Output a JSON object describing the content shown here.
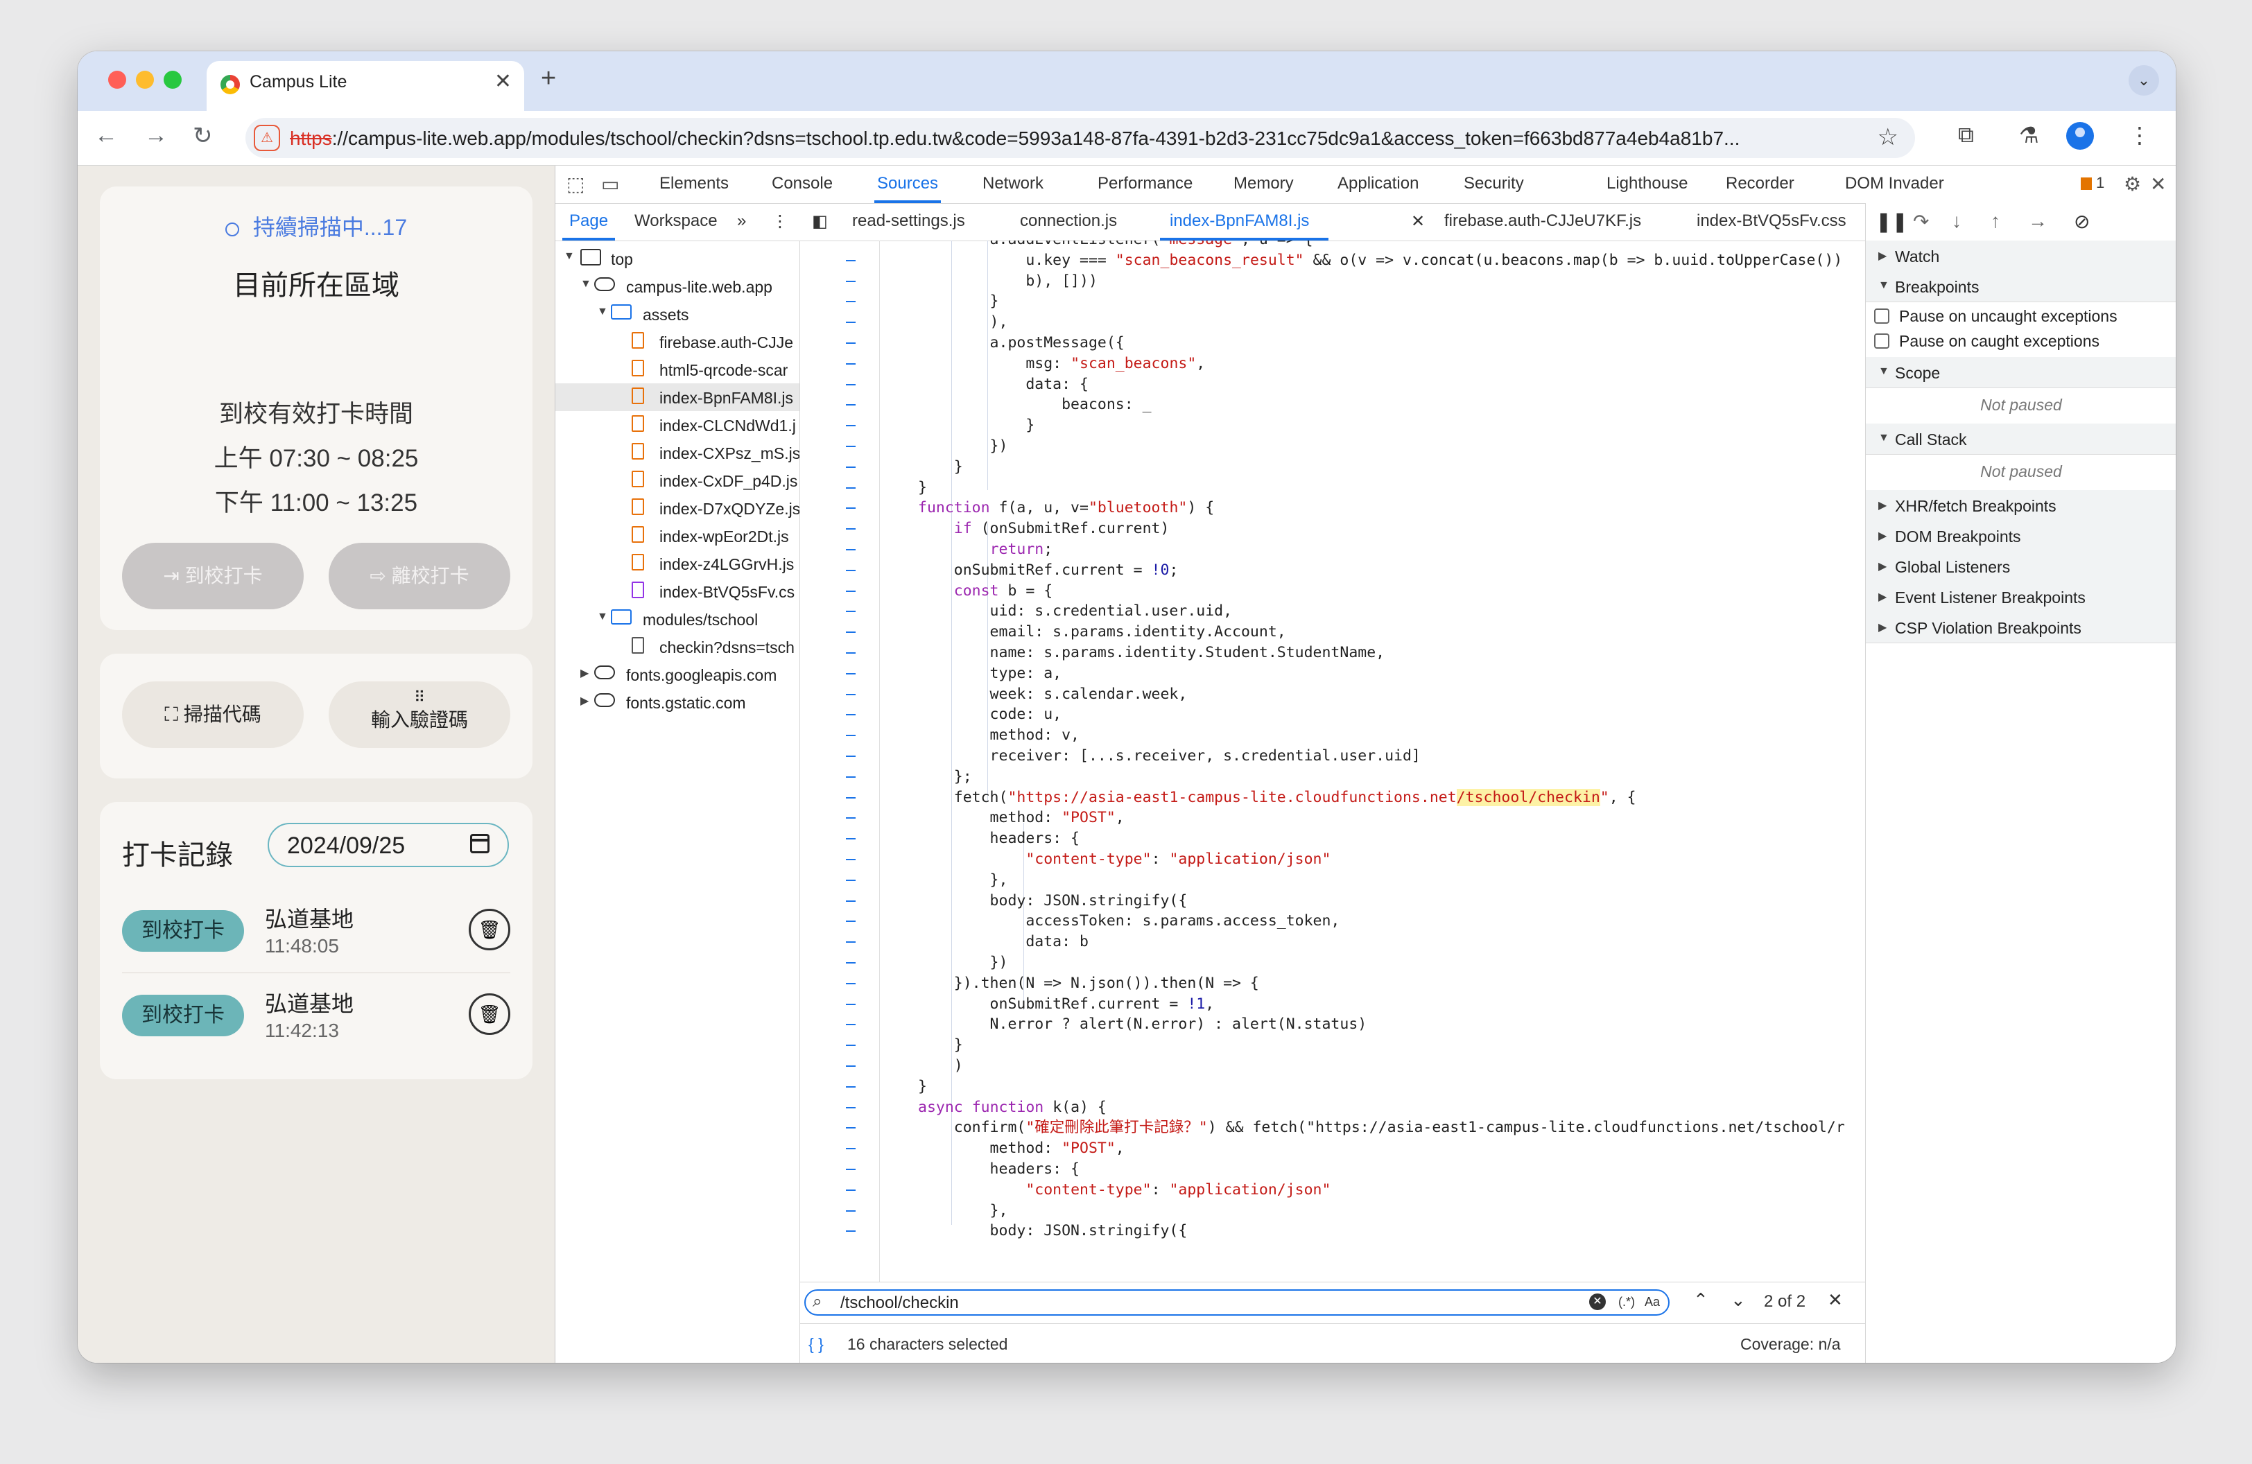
{
  "browser": {
    "tab_title": "Campus Lite",
    "tab_close": "✕",
    "new_tab": "+",
    "url_scheme": "https",
    "url_rest": "://campus-lite.web.app/modules/tschool/checkin?dsns=tschool.tp.edu.tw&code=5993a148-87fa-4391-b2d3-231cc75dc9a1&access_token=f663bd877a4eb4a81b7..."
  },
  "app": {
    "scan_status": "持續掃描中...17",
    "area_title": "目前所在區域",
    "time_title": "到校有效打卡時間",
    "time_morning": "上午 07:30 ~ 08:25",
    "time_noon": "下午 11:00 ~ 13:25",
    "arrive_button": "到校打卡",
    "leave_button": "離校打卡",
    "scan_code_button": "掃描代碼",
    "enter_code_button": "輸入驗證碼",
    "record_title": "打卡記錄",
    "record_date": "2024/09/25",
    "records": [
      {
        "type": "到校打卡",
        "location": "弘道基地",
        "time": "11:48:05"
      },
      {
        "type": "到校打卡",
        "location": "弘道基地",
        "time": "11:42:13"
      }
    ]
  },
  "devtools": {
    "tabs": [
      "Elements",
      "Console",
      "Sources",
      "Network",
      "Performance",
      "Memory",
      "Application",
      "Security",
      "Lighthouse",
      "Recorder",
      "DOM Invader"
    ],
    "active_tab": "Sources",
    "issues_count": "1",
    "nav_tabs": [
      "Page",
      "Workspace"
    ],
    "file_tabs": [
      "read-settings.js",
      "connection.js",
      "index-BpnFAM8I.js",
      "firebase.auth-CJJeU7KF.js",
      "index-BtVQ5sFv.css"
    ],
    "tree": {
      "top": "top",
      "domain": "campus-lite.web.app",
      "assets": "assets",
      "files": [
        "firebase.auth-CJJe",
        "html5-qrcode-scar",
        "index-BpnFAM8I.js",
        "index-CLCNdWd1.j",
        "index-CXPsz_mS.js",
        "index-CxDF_p4D.js",
        "index-D7xQDYZe.js",
        "index-wpEor2Dt.js",
        "index-z4LGGrvH.js",
        "index-BtVQ5sFv.cs"
      ],
      "modules": "modules/tschool",
      "checkin": "checkin?dsns=tsch",
      "fonts1": "fonts.googleapis.com",
      "fonts2": "fonts.gstatic.com"
    },
    "search": {
      "value": "/tschool/checkin",
      "regex": "(.*)",
      "case": "Aa",
      "count": "2 of 2"
    },
    "status": {
      "selection": "16 characters selected",
      "coverage": "Coverage: n/a"
    },
    "debugger": {
      "watch": "Watch",
      "breakpoints": "Breakpoints",
      "pause_uncaught": "Pause on uncaught exceptions",
      "pause_caught": "Pause on caught exceptions",
      "scope": "Scope",
      "not_paused_1": "Not paused",
      "call_stack": "Call Stack",
      "not_paused_2": "Not paused",
      "xhr": "XHR/fetch Breakpoints",
      "dom": "DOM Breakpoints",
      "global": "Global Listeners",
      "event": "Event Listener Breakpoints",
      "csp": "CSP Violation Breakpoints"
    }
  }
}
